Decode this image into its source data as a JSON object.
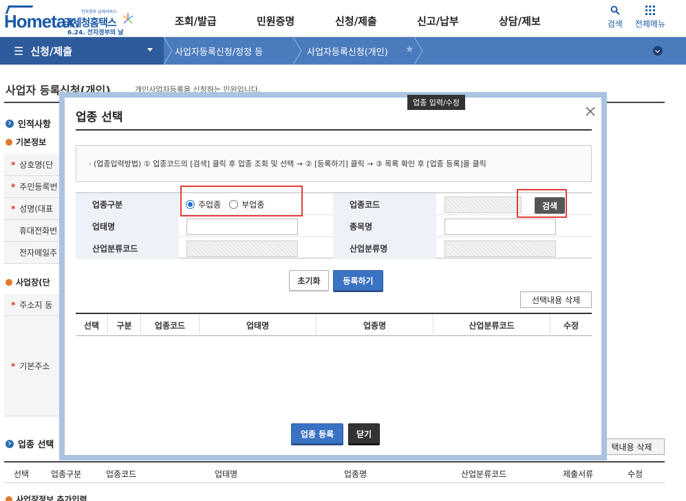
{
  "header": {
    "logo_text": "Hometax.",
    "logo_small": "전자정부 납세서비스",
    "logo_name": "국세청홈택스",
    "logo_day": "6.24. 전자정부의 날",
    "menu": [
      "조회/발급",
      "민원증명",
      "신청/제출",
      "신고/납부",
      "상담/제보"
    ],
    "search_label": "검색",
    "allmenu_label": "전체메뉴"
  },
  "nav": {
    "current": "신청/제출",
    "crumbs": [
      "사업자등록신청/정정 등",
      "사업자등록신청(개인)"
    ]
  },
  "page": {
    "title": "사업자 등록신청(개인)",
    "desc": "개인사업자등록을 신청하는 민원입니다.",
    "section_personal": "인적사항",
    "section_basic": "기본정보",
    "rows": [
      "상호명(단",
      "주민등록번",
      "성명(대표",
      "휴대전화번",
      "전자메일주"
    ],
    "section_business": "사업장(단",
    "address_row": "주소지 동",
    "base_address": "기본주소",
    "section_industry": "업종 선택",
    "delete_btn": "택내용 삭제",
    "table_cols": [
      "선택",
      "업종구분",
      "업종코드",
      "업태명",
      "업종명",
      "산업분류코드",
      "제출서류",
      "수정"
    ],
    "bottom_section": "사업장정보 추가입력"
  },
  "modal": {
    "title": "업종 선택",
    "tooltip": "업종 입력/수정",
    "info": "· (업종입력방법) ① 업종코드의 [검색] 클릭 후 업종 조회 및 선택 → ② [등록하기] 클릭 → ③ 목록 확인 후 [업종 등록]을 클릭",
    "labels": {
      "type": "업종구분",
      "code": "업종코드",
      "biz_name": "업태명",
      "item_name": "종목명",
      "ind_code": "산업분류코드",
      "ind_name": "산업분류명"
    },
    "radio_main": "주업종",
    "radio_sub": "부업종",
    "radio_selected": "주업종",
    "search_btn": "검색",
    "reset_btn": "초기화",
    "register_btn": "등록하기",
    "delete_btn": "선택내용 삭제",
    "list_cols": [
      "선택",
      "구분",
      "업종코드",
      "업태명",
      "업종명",
      "산업분류코드",
      "수정"
    ],
    "submit_btn": "업종 등록",
    "close_btn": "닫기"
  }
}
